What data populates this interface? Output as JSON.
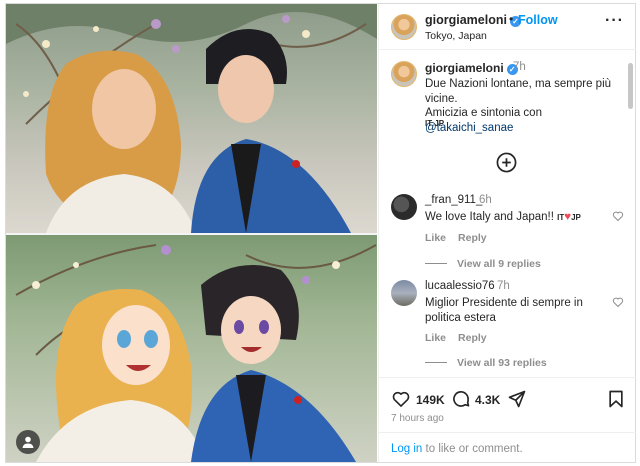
{
  "header": {
    "username": "giorgiameloni",
    "separator": "•",
    "follow_label": "Follow",
    "location": "Tokyo, Japan",
    "more_label": "···"
  },
  "caption": {
    "username": "giorgiameloni",
    "time": "7h",
    "line1": "Due Nazioni lontane, ma sempre più vicine.",
    "line2_prefix": "Amicizia e sintonia con ",
    "mention": "@takaichi_sanae",
    "flags": "IT JP"
  },
  "comments": [
    {
      "username": "_fran_911_",
      "time": "6h",
      "text_prefix": "We love Italy and Japan!! ",
      "flag1": "IT",
      "heart": "♥",
      "flag2": "JP",
      "like_label": "Like",
      "reply_label": "Reply",
      "view_replies": "View all 9 replies"
    },
    {
      "username": "lucaalessio76",
      "time": "7h",
      "text": "Miglior Presidente di sempre in politica estera",
      "like_label": "Like",
      "reply_label": "Reply",
      "view_replies": "View all 93 replies"
    }
  ],
  "actions": {
    "likes": "149K",
    "comments": "4.3K",
    "time_ago": "7 hours ago"
  },
  "footer": {
    "login_link": "Log in",
    "login_suffix": " to like or comment."
  },
  "icons": {
    "verified": "verified-badge-icon",
    "add": "add-circle-icon",
    "heart": "heart-icon",
    "comment": "comment-icon",
    "share": "share-icon",
    "save": "bookmark-icon",
    "user_tag": "user-tag-icon"
  },
  "colors": {
    "accent": "#0095f6",
    "verified": "#3897f0",
    "text": "#262626",
    "muted": "#8e8e8e",
    "heart": "#ed4956"
  }
}
